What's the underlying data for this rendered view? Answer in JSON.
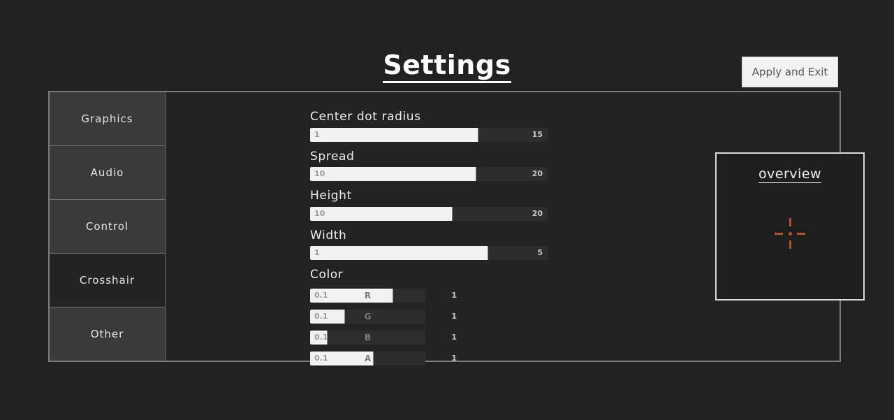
{
  "header": {
    "title": "Settings",
    "apply_button": "Apply and Exit"
  },
  "sidebar": {
    "items": [
      {
        "label": "Graphics",
        "selected": false
      },
      {
        "label": "Audio",
        "selected": false
      },
      {
        "label": "Control",
        "selected": false
      },
      {
        "label": "Crosshair",
        "selected": true
      },
      {
        "label": "Other",
        "selected": false
      }
    ]
  },
  "crosshair_settings": {
    "sliders": [
      {
        "label": "Center dot radius",
        "min": "1",
        "max": "15",
        "fill_percent": 71
      },
      {
        "label": "Spread",
        "min": "10",
        "max": "20",
        "fill_percent": 70
      },
      {
        "label": "Height",
        "min": "10",
        "max": "20",
        "fill_percent": 60
      },
      {
        "label": "Width",
        "min": "1",
        "max": "5",
        "fill_percent": 75
      }
    ],
    "color_label": "Color",
    "color_channels": [
      {
        "channel": "R",
        "min": "0.1",
        "max": "1",
        "fill_percent": 72
      },
      {
        "channel": "G",
        "min": "0.1",
        "max": "1",
        "fill_percent": 30
      },
      {
        "channel": "B",
        "min": "0.1",
        "max": "1",
        "fill_percent": 15
      },
      {
        "channel": "A",
        "min": "0.1",
        "max": "1",
        "fill_percent": 55
      }
    ]
  },
  "overview": {
    "title": "overview",
    "crosshair_color": "#b4522a"
  },
  "colors": {
    "background": "#222222",
    "panel": "#232323",
    "panel_border": "#7d7d7d",
    "tab_unselected": "#3a3a3a",
    "tab_selected": "#232323",
    "slider_track": "#2d2d2d",
    "slider_fill": "#f2f2f2",
    "accent": "#b4522a"
  }
}
